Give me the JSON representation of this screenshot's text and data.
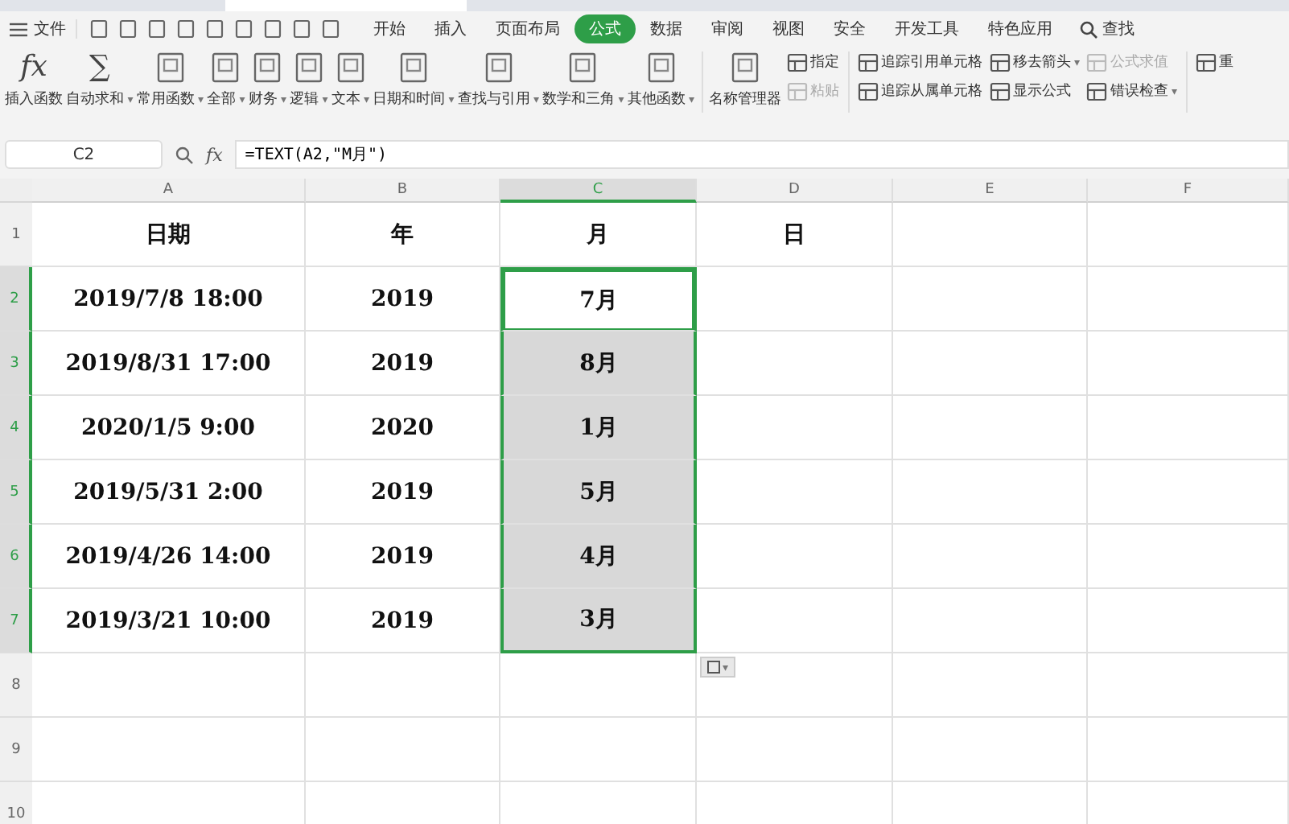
{
  "menu": {
    "file": "文件",
    "tabs": [
      {
        "label": "开始",
        "selected": false
      },
      {
        "label": "插入",
        "selected": false
      },
      {
        "label": "页面布局",
        "selected": false
      },
      {
        "label": "公式",
        "selected": true
      },
      {
        "label": "数据",
        "selected": false
      },
      {
        "label": "审阅",
        "selected": false
      },
      {
        "label": "视图",
        "selected": false
      },
      {
        "label": "安全",
        "selected": false
      },
      {
        "label": "开发工具",
        "selected": false
      },
      {
        "label": "特色应用",
        "selected": false
      }
    ],
    "search": "查找"
  },
  "ribbon": {
    "big_buttons": [
      {
        "label": "插入函数",
        "glyph": "fx"
      },
      {
        "label": "自动求和",
        "caret": "▾",
        "glyph": "∑"
      },
      {
        "label": "常用函数",
        "caret": "▾"
      },
      {
        "label": "全部",
        "caret": "▾"
      },
      {
        "label": "财务",
        "caret": "▾"
      },
      {
        "label": "逻辑",
        "caret": "▾"
      },
      {
        "label": "文本",
        "caret": "▾"
      },
      {
        "label": "日期和时间",
        "caret": "▾"
      },
      {
        "label": "查找与引用",
        "caret": "▾"
      },
      {
        "label": "数学和三角",
        "caret": "▾"
      },
      {
        "label": "其他函数",
        "caret": "▾"
      },
      {
        "label": "名称管理器"
      }
    ],
    "small_columns": [
      [
        {
          "label": "指定",
          "disabled": false
        },
        {
          "label": "粘贴",
          "disabled": true
        }
      ],
      [
        {
          "label": "追踪引用单元格",
          "disabled": false
        },
        {
          "label": "追踪从属单元格",
          "disabled": false
        }
      ],
      [
        {
          "label": "移去箭头",
          "disabled": false,
          "caret": "▾"
        },
        {
          "label": "显示公式",
          "disabled": false
        }
      ],
      [
        {
          "label": "公式求值",
          "disabled": true
        },
        {
          "label": "错误检查",
          "disabled": false,
          "caret": "▾"
        }
      ],
      [
        {
          "label": "重",
          "disabled": false
        }
      ]
    ]
  },
  "formula_bar": {
    "cell_ref": "C2",
    "fx": "fx",
    "formula": "=TEXT(A2,\"M月\")"
  },
  "sheet": {
    "columns": [
      {
        "label": "A",
        "selected": false
      },
      {
        "label": "B",
        "selected": false
      },
      {
        "label": "C",
        "selected": true
      },
      {
        "label": "D",
        "selected": false
      },
      {
        "label": "E",
        "selected": false
      },
      {
        "label": "F",
        "selected": false
      }
    ],
    "rows": [
      {
        "header": "1",
        "selected": false,
        "cells": [
          {
            "text": "日期",
            "selected": false,
            "active": false
          },
          {
            "text": "年",
            "selected": false,
            "active": false
          },
          {
            "text": "月",
            "selected": false,
            "active": false
          },
          {
            "text": "日",
            "selected": false,
            "active": false
          }
        ]
      },
      {
        "header": "2",
        "selected": true,
        "cells": [
          {
            "text": "2019/7/8 18:00",
            "selected": false,
            "active": false
          },
          {
            "text": "2019",
            "selected": false,
            "active": false
          },
          {
            "text": "7月",
            "selected": true,
            "active": true
          }
        ]
      },
      {
        "header": "3",
        "selected": true,
        "cells": [
          {
            "text": "2019/8/31 17:00",
            "selected": false,
            "active": false
          },
          {
            "text": "2019",
            "selected": false,
            "active": false
          },
          {
            "text": "8月",
            "selected": true,
            "active": false
          }
        ]
      },
      {
        "header": "4",
        "selected": true,
        "cells": [
          {
            "text": "2020/1/5 9:00",
            "selected": false,
            "active": false
          },
          {
            "text": "2020",
            "selected": false,
            "active": false
          },
          {
            "text": "1月",
            "selected": true,
            "active": false
          }
        ]
      },
      {
        "header": "5",
        "selected": true,
        "cells": [
          {
            "text": "2019/5/31 2:00",
            "selected": false,
            "active": false
          },
          {
            "text": "2019",
            "selected": false,
            "active": false
          },
          {
            "text": "5月",
            "selected": true,
            "active": false
          }
        ]
      },
      {
        "header": "6",
        "selected": true,
        "cells": [
          {
            "text": "2019/4/26 14:00",
            "selected": false,
            "active": false
          },
          {
            "text": "2019",
            "selected": false,
            "active": false
          },
          {
            "text": "4月",
            "selected": true,
            "active": false
          }
        ]
      },
      {
        "header": "7",
        "selected": true,
        "cells": [
          {
            "text": "2019/3/21 10:00",
            "selected": false,
            "active": false
          },
          {
            "text": "2019",
            "selected": false,
            "active": false
          },
          {
            "text": "3月",
            "selected": true,
            "active": false
          }
        ]
      },
      {
        "header": "8",
        "selected": false,
        "cells": [],
        "paste_caret": "▾"
      },
      {
        "header": "9",
        "selected": false,
        "cells": []
      },
      {
        "header": "10",
        "selected": false,
        "cells": []
      }
    ]
  }
}
